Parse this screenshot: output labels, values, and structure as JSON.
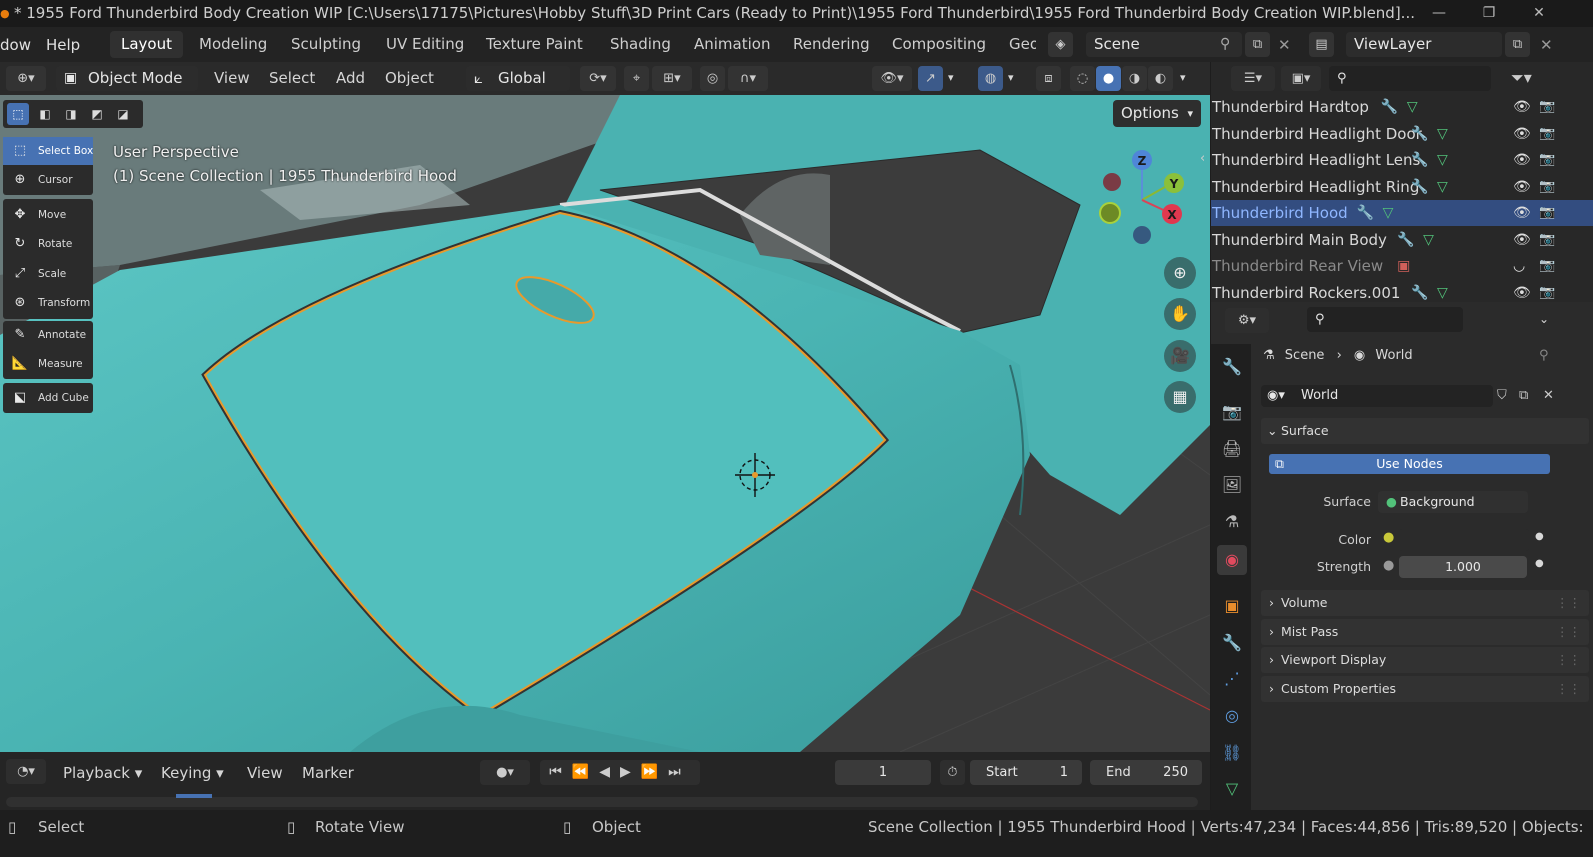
{
  "window": {
    "title": "* 1955 Ford Thunderbird Body Creation WIP [C:\\Users\\17175\\Pictures\\Hobby Stuff\\3D Print Cars (Ready to Print)\\1955 Ford Thunderbird\\1955 Ford Thunderbird Body Creation WIP.blend]...",
    "minimize": "—",
    "maximize": "❐",
    "close": "✕"
  },
  "menubar": {
    "menus": [
      "dow",
      "Help"
    ],
    "workspaces": [
      "Layout",
      "Modeling",
      "Sculpting",
      "UV Editing",
      "Texture Paint",
      "Shading",
      "Animation",
      "Rendering",
      "Compositing",
      "Geo"
    ],
    "active_workspace": "Layout",
    "scene": "Scene",
    "view_layer": "ViewLayer"
  },
  "viewport_header": {
    "mode": "Object Mode",
    "menus": [
      "View",
      "Select",
      "Add",
      "Object"
    ],
    "transform_orientation": "Global",
    "options": "Options"
  },
  "viewport": {
    "overlay_line1": "User Perspective",
    "overlay_line2": "(1) Scene Collection | 1955 Thunderbird Hood",
    "gizmo": {
      "z": "Z",
      "y": "Y",
      "x": "X"
    },
    "tools": [
      "Select Box",
      "Cursor",
      "Move",
      "Rotate",
      "Scale",
      "Transform",
      "Annotate",
      "Measure",
      "Add Cube"
    ],
    "active_tool": "Select Box",
    "body_color": "#4fb8b8",
    "selection_color": "#e89a2c"
  },
  "outliner": {
    "items": [
      {
        "name": "Thunderbird Hardtop",
        "selected": false,
        "dim": false
      },
      {
        "name": "Thunderbird Headlight Door",
        "selected": false,
        "dim": false
      },
      {
        "name": "Thunderbird Headlight Lens",
        "selected": false,
        "dim": false
      },
      {
        "name": "Thunderbird Headlight Ring",
        "selected": false,
        "dim": false
      },
      {
        "name": "Thunderbird Hood",
        "selected": true,
        "dim": false
      },
      {
        "name": "Thunderbird Main Body",
        "selected": false,
        "dim": false
      },
      {
        "name": "Thunderbird Rear View",
        "selected": false,
        "dim": true
      },
      {
        "name": "Thunderbird Rockers.001",
        "selected": false,
        "dim": false
      }
    ]
  },
  "properties": {
    "breadcrumb_scene": "Scene",
    "breadcrumb_world": "World",
    "world_name": "World",
    "surface_panel": "Surface",
    "use_nodes": "Use Nodes",
    "surface_label": "Surface",
    "surface_value": "Background",
    "color_label": "Color",
    "strength_label": "Strength",
    "strength_value": "1.000",
    "collapsed_panels": [
      "Volume",
      "Mist Pass",
      "Viewport Display",
      "Custom Properties"
    ]
  },
  "timeline": {
    "menus": [
      "Playback",
      "Keying",
      "View",
      "Marker"
    ],
    "current_frame": "1",
    "start_label": "Start",
    "start_value": "1",
    "end_label": "End",
    "end_value": "250"
  },
  "statusbar": {
    "select": "Select",
    "rotate_view": "Rotate View",
    "object": "Object",
    "stats": "Scene Collection | 1955 Thunderbird Hood | Verts:47,234 | Faces:44,856 | Tris:89,520 | Objects:"
  }
}
